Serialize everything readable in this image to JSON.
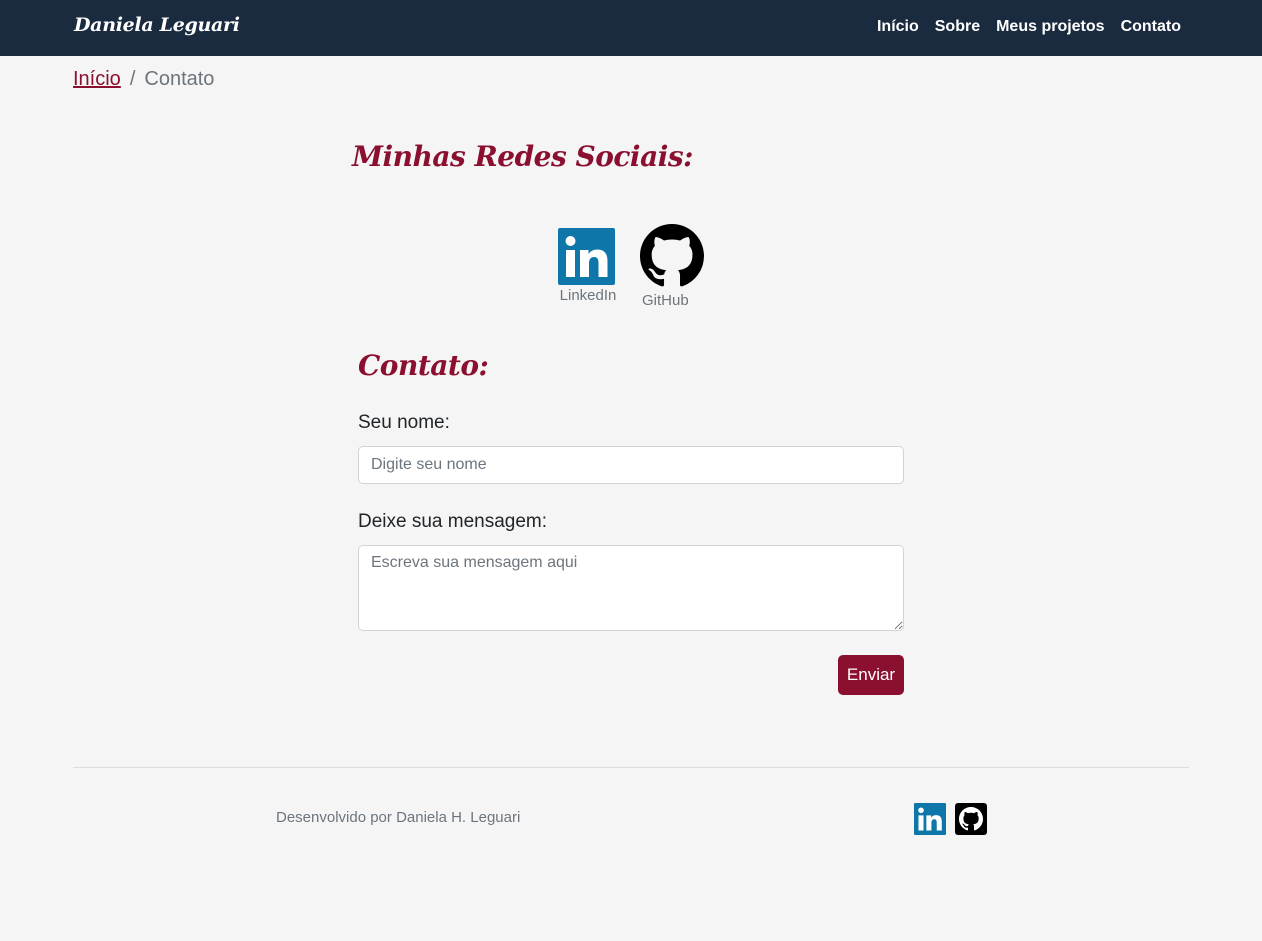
{
  "navbar": {
    "brand": "Daniela Leguari",
    "links": [
      {
        "label": "Início"
      },
      {
        "label": "Sobre"
      },
      {
        "label": "Meus projetos"
      },
      {
        "label": "Contato"
      }
    ],
    "background": "#1a2b40"
  },
  "breadcrumb": {
    "home": "Início",
    "separator": "/",
    "current": "Contato"
  },
  "social": {
    "title": "Minhas Redes Sociais:",
    "items": [
      {
        "label": "LinkedIn",
        "icon": "linkedin-icon"
      },
      {
        "label": "GitHub",
        "icon": "github-icon"
      }
    ]
  },
  "contact": {
    "title": "Contato:",
    "name_label": "Seu nome:",
    "name_value": "",
    "name_placeholder": "Digite seu nome",
    "message_label": "Deixe sua mensagem:",
    "message_value": "",
    "message_placeholder": "Escreva sua mensagem aqui",
    "submit_label": "Enviar"
  },
  "footer": {
    "credit": "Desenvolvido por Daniela H. Leguari",
    "icons": [
      "linkedin-icon",
      "github-icon"
    ]
  },
  "colors": {
    "accent": "#8b1030",
    "navbar": "#1a2b40",
    "background": "#f5f5f5",
    "muted_text": "#6c757d",
    "linkedin_blue": "#0e76a8"
  }
}
